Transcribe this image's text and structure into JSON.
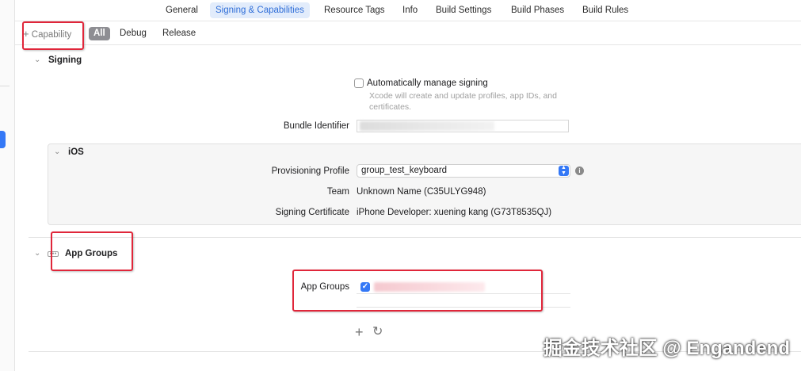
{
  "top_tabs": [
    "General",
    "Signing & Capabilities",
    "Resource Tags",
    "Info",
    "Build Settings",
    "Build Phases",
    "Build Rules"
  ],
  "filter": {
    "capability_label": "Capability",
    "pills": [
      "All",
      "Debug",
      "Release"
    ]
  },
  "signing": {
    "title": "Signing",
    "auto_manage_label": "Automatically manage signing",
    "auto_manage_hint": "Xcode will create and update profiles, app IDs, and certificates.",
    "bundle_identifier_label": "Bundle Identifier"
  },
  "ios": {
    "title": "iOS",
    "provisioning_profile_label": "Provisioning Profile",
    "provisioning_profile_value": "group_test_keyboard",
    "team_label": "Team",
    "team_value": "Unknown Name (C35ULYG948)",
    "signing_certificate_label": "Signing Certificate",
    "signing_certificate_value": "iPhone Developer: xuening kang (G73T8535QJ)"
  },
  "app_groups": {
    "title": "App Groups",
    "field_label": "App Groups"
  },
  "watermark": "掘金技术社区 @ Engandend",
  "colors": {
    "accent": "#3478f6",
    "annotation_red": "#e0263a"
  }
}
